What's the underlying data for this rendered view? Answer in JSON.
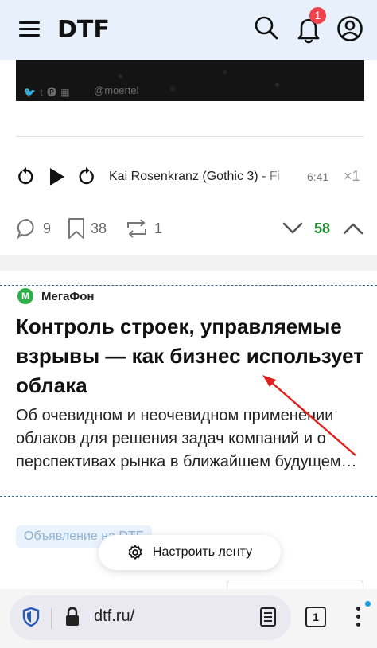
{
  "header": {
    "logo": "DTF",
    "notification_count": "1"
  },
  "post": {
    "media_credit": "@moertel",
    "media_social": "🐦 t 🅟 ▦",
    "player": {
      "track": "Kai Rosenkranz (Gothic 3) - Fi",
      "time": "6:41",
      "speed": "×1"
    },
    "stats": {
      "comments": "9",
      "bookmarks": "38",
      "reposts": "1",
      "rating": "58"
    }
  },
  "ad": {
    "brand": "МегаФон",
    "brand_logo_letter": "М",
    "title": "Контроль строек, управляемые взрывы — как бизнес использует облака",
    "description": "Об очевидном и неочевидном применении облаков для решения задач компаний и о перспективах рынка в ближайшем будущем…",
    "label": "Объявление на DTF"
  },
  "feed_button": "Настроить ленту",
  "browser": {
    "url": "dtf.ru/",
    "tab_count": "1"
  },
  "colors": {
    "header_bg": "#e8f1fb",
    "rating_green": "#27913a",
    "badge_red": "#f0424b",
    "annotation_arrow": "#e0201c"
  },
  "icons": [
    "menu-icon",
    "search-icon",
    "bell-icon",
    "account-icon",
    "rewind-icon",
    "play-icon",
    "forward-icon",
    "comment-icon",
    "bookmark-icon",
    "repost-icon",
    "chevron-down-icon",
    "chevron-up-icon",
    "gear-icon",
    "shield-icon",
    "lock-icon",
    "reader-icon",
    "more-icon"
  ]
}
